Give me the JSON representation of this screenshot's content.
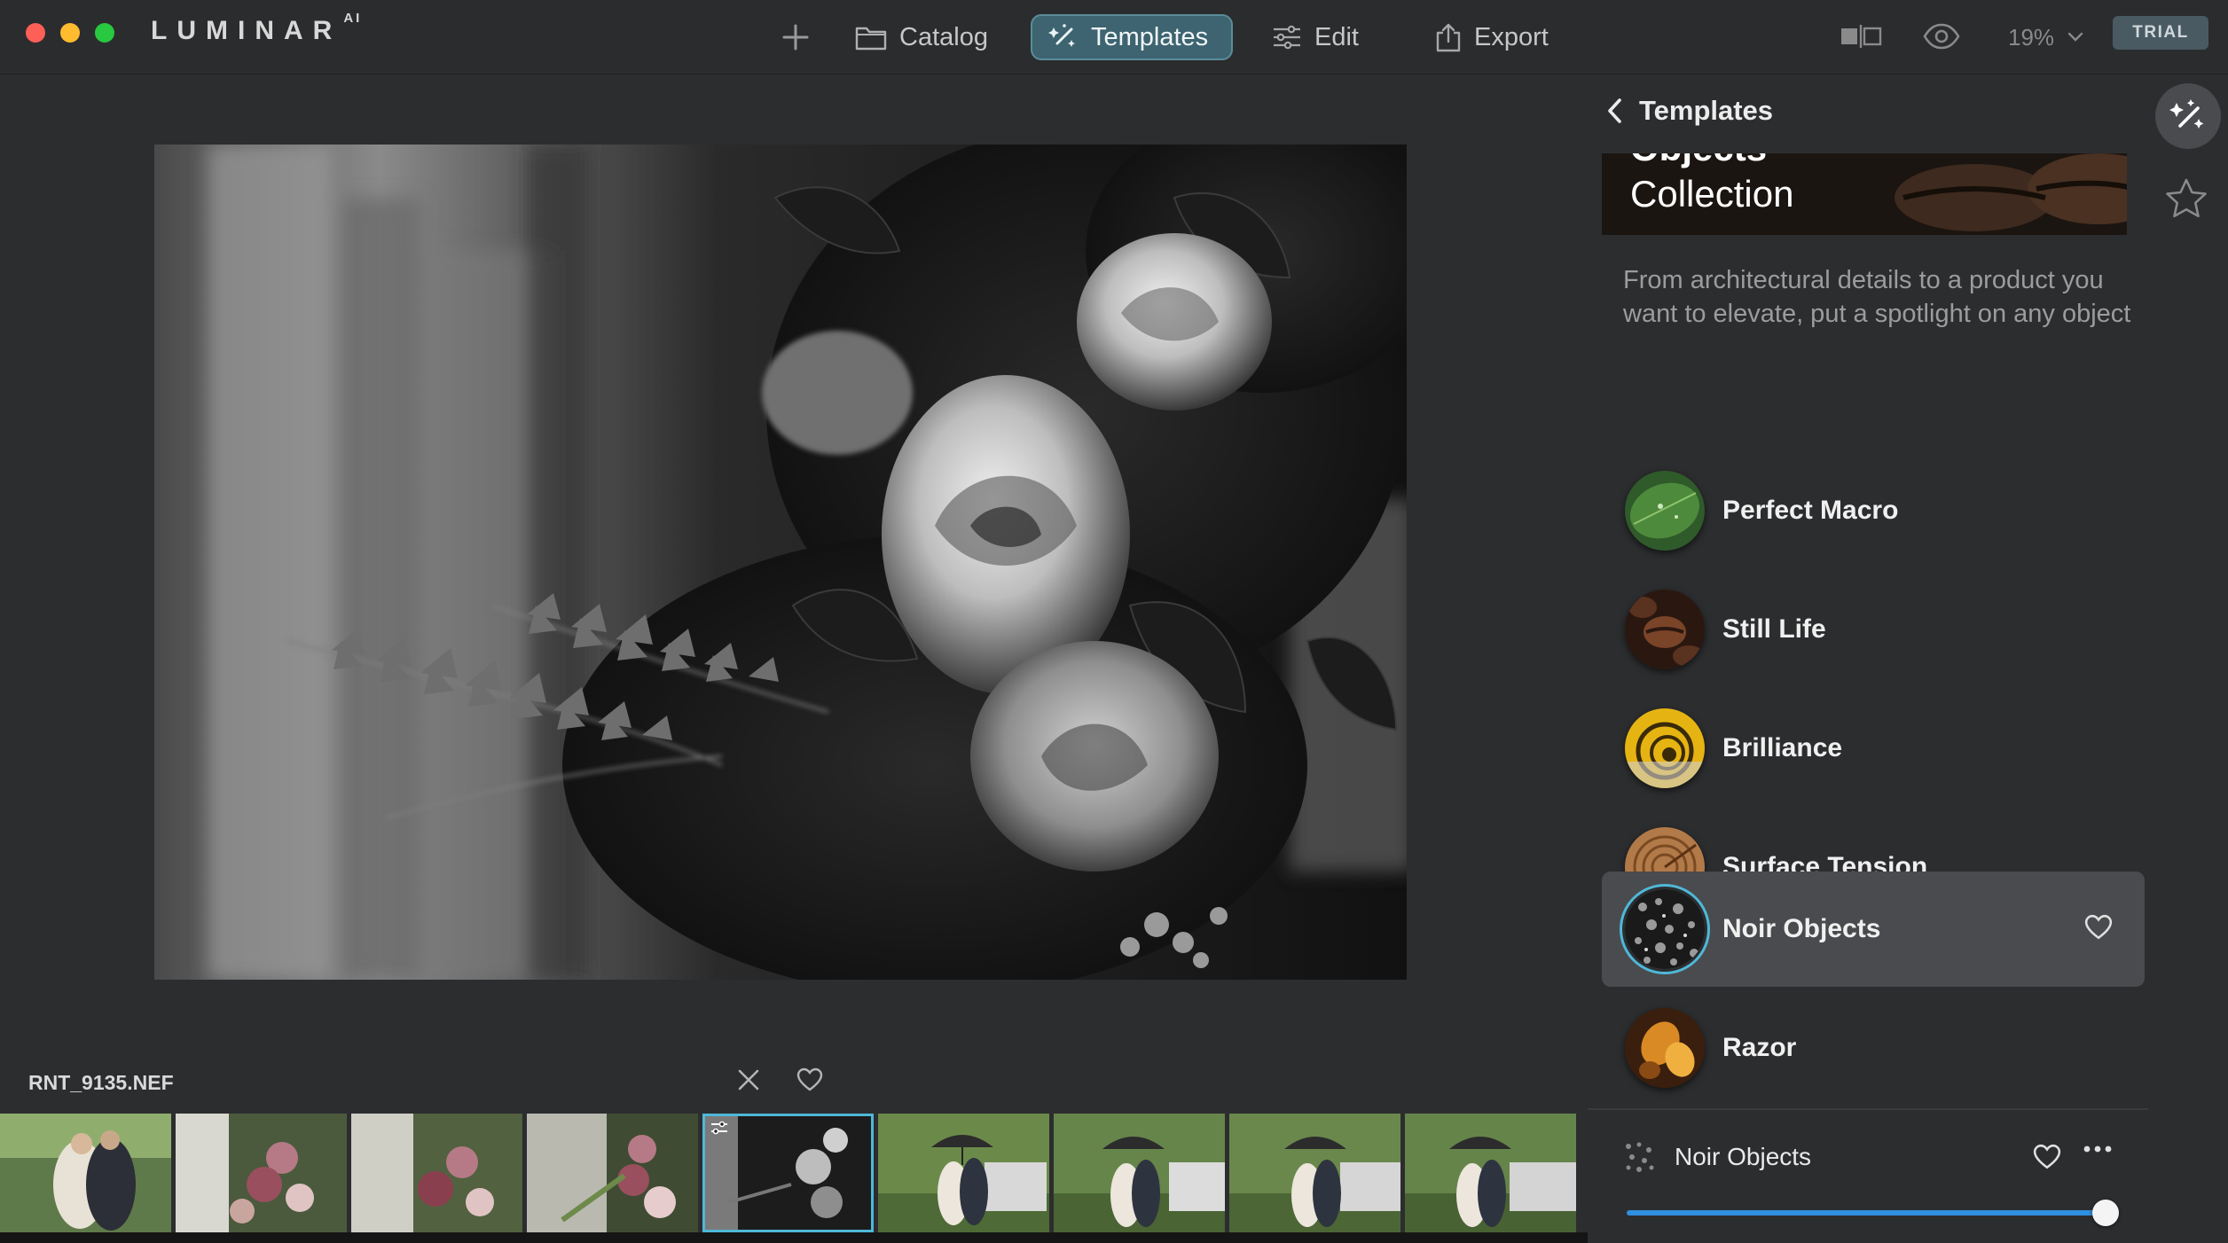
{
  "app": {
    "logo_text": "LUMINAR",
    "logo_sup": "AI"
  },
  "nav": {
    "catalog": "Catalog",
    "templates": "Templates",
    "edit": "Edit",
    "export": "Export"
  },
  "toolbar": {
    "zoom": "19%",
    "trial": "TRIAL"
  },
  "colors": {
    "accent": "#4fb8d8",
    "templates_active_bg": "#3d6470",
    "slider_fill": "#2f8fe0"
  },
  "panel": {
    "back_label": "Templates",
    "banner_partial": "Objects",
    "banner_title": "Collection",
    "description": "From architectural details to a product you want to elevate, put a spotlight on any object",
    "templates": [
      {
        "label": "Perfect Macro",
        "icon": "leaf-macro-thumb"
      },
      {
        "label": "Still Life",
        "icon": "coffee-beans-thumb"
      },
      {
        "label": "Brilliance",
        "icon": "spiral-shell-thumb"
      },
      {
        "label": "Surface Tension",
        "icon": "wood-rings-thumb"
      },
      {
        "label": "Noir Objects",
        "icon": "noir-texture-thumb",
        "active": true
      },
      {
        "label": "Razor",
        "icon": "golden-objects-thumb"
      }
    ],
    "applied": {
      "label": "Noir Objects",
      "amount": 1.0
    }
  },
  "image": {
    "filename": "RNT_9135.NEF"
  },
  "filmstrip": {
    "count": 9,
    "selected_index": 4
  }
}
